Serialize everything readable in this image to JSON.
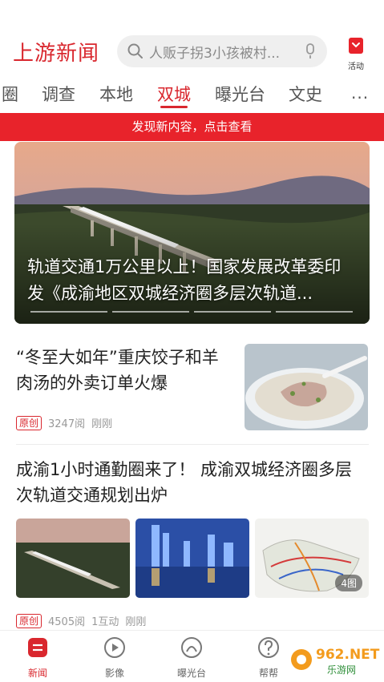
{
  "header": {
    "logo": "上游新闻",
    "search_placeholder": "人贩子拐3小孩被村...",
    "activity_label": "活动"
  },
  "tabs": [
    {
      "label": "圈"
    },
    {
      "label": "调查"
    },
    {
      "label": "本地"
    },
    {
      "label": "双城",
      "active": true
    },
    {
      "label": "曝光台"
    },
    {
      "label": "文史"
    }
  ],
  "tabs_more": "···",
  "banner": "发现新内容，点击查看",
  "hero": {
    "title": "轨道交通1万公里以上！国家发展改革委印发《成渝地区双城经济圈多层次轨道..."
  },
  "articles": [
    {
      "title": "“冬至大如年”重庆饺子和羊肉汤的外卖订单火爆",
      "badge": "原创",
      "reads": "3247阅",
      "time": "刚刚"
    },
    {
      "title": "成渝1小时通勤圈来了！ 成渝双城经济圈多层次轨道交通规划出炉",
      "badge": "原创",
      "reads": "4505阅",
      "interactions": "1互动",
      "time": "刚刚",
      "image_count": "4图"
    }
  ],
  "bottom_nav": [
    {
      "label": "新闻",
      "icon": "news-icon",
      "active": true
    },
    {
      "label": "影像",
      "icon": "video-icon"
    },
    {
      "label": "曝光台",
      "icon": "exposure-icon"
    },
    {
      "label": "帮帮",
      "icon": "help-icon"
    }
  ],
  "watermark": {
    "text_top": "962.NET",
    "text_bottom": "乐游网"
  },
  "colors": {
    "accent": "#d9272e",
    "banner": "#e8232b"
  }
}
